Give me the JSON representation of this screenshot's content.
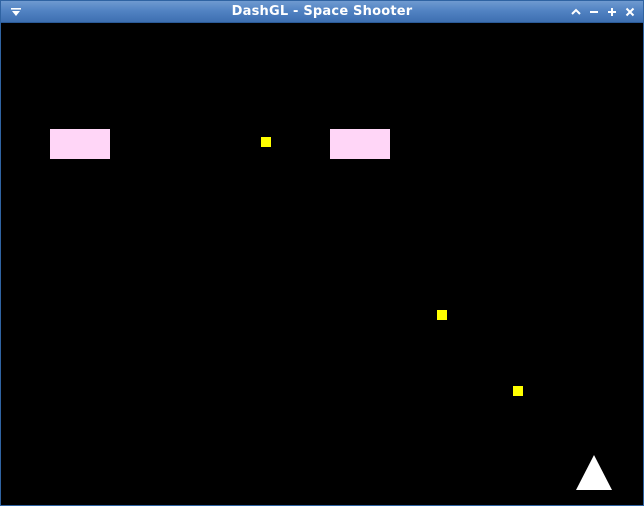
{
  "window": {
    "title": "DashGL - Space Shooter",
    "icons": {
      "menu": "window-menu-icon",
      "shade": "window-shade-icon",
      "minimize": "window-minimize-icon",
      "maximize": "window-maximize-icon",
      "close": "window-close-icon"
    },
    "colors": {
      "titlebar": "#4f81c1",
      "border": "#2f63a2",
      "title_text": "#ffffff",
      "background": "#000000"
    }
  },
  "game": {
    "sprites": {
      "enemy_count": 2,
      "bullet_count": 3,
      "player": "white triangle ship"
    },
    "colors": {
      "enemy": "#ffd6f7",
      "bullet": "#ffff00",
      "player": "#ffffff"
    }
  }
}
